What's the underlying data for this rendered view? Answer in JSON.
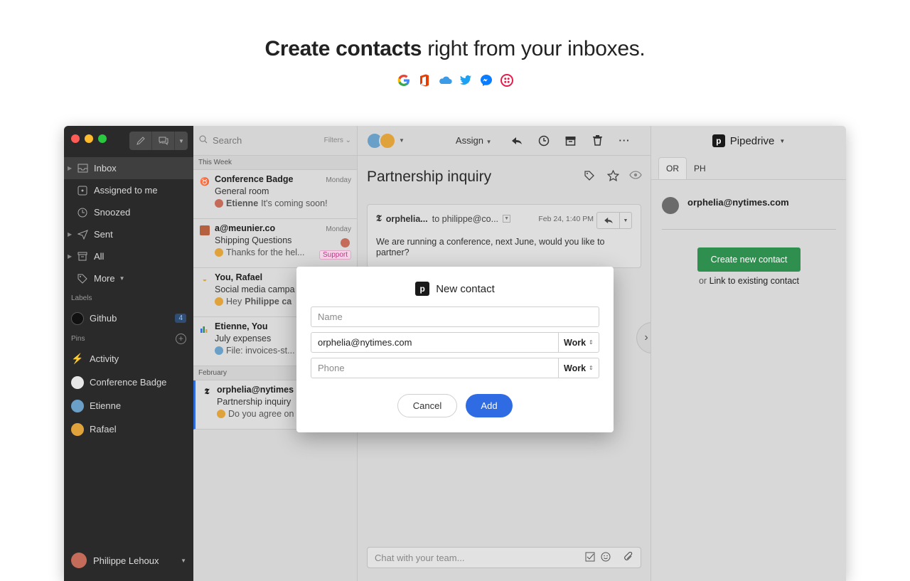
{
  "hero": {
    "title_bold_1": "Create",
    "title_bold_2": "contacts",
    "title_rest": "right from your inboxes.",
    "icons": [
      "google-icon",
      "office-icon",
      "icloud-icon",
      "twitter-icon",
      "messenger-icon",
      "twilio-icon"
    ]
  },
  "sidebar": {
    "nav": [
      {
        "label": "Inbox",
        "icon": "inbox-icon",
        "caret": true
      },
      {
        "label": "Assigned to me",
        "icon": "assigned-icon",
        "caret": false
      },
      {
        "label": "Snoozed",
        "icon": "clock-icon",
        "caret": false
      },
      {
        "label": "Sent",
        "icon": "send-icon",
        "caret": true
      },
      {
        "label": "All",
        "icon": "archive-icon",
        "caret": true
      },
      {
        "label": "More",
        "icon": "tag-icon",
        "caret": false
      }
    ],
    "labels_header": "Labels",
    "labels": [
      {
        "label": "Github",
        "count": "4"
      }
    ],
    "pins_header": "Pins",
    "pins": [
      {
        "label": "Activity"
      },
      {
        "label": "Conference Badge"
      },
      {
        "label": "Etienne"
      },
      {
        "label": "Rafael"
      }
    ],
    "user": "Philippe Lehoux"
  },
  "list": {
    "search_placeholder": "Search",
    "filters": "Filters",
    "this_week": "This Week",
    "february": "February",
    "conversations": [
      {
        "who": "Conference Badge",
        "date": "Monday",
        "subject": "General room",
        "preview_name": "Etienne",
        "preview": "It's coming soon!"
      },
      {
        "who": "a@meunier.co",
        "date": "Monday",
        "subject": "Shipping Questions",
        "preview_name": "",
        "preview": "Thanks for the hel...",
        "tag": "Support"
      },
      {
        "who": "You, Rafael",
        "date": "",
        "subject": "Social media campa",
        "preview_name": "Hey",
        "preview": "Philippe ca"
      },
      {
        "who": "Etienne, You",
        "date": "",
        "subject": "July expenses",
        "preview_name": "",
        "preview": "File: invoices-st..."
      },
      {
        "who": "orphelia@nytimes",
        "date": "",
        "subject": "Partnership inquiry",
        "preview_name": "",
        "preview": "Do you agree on"
      }
    ]
  },
  "main": {
    "assign": "Assign",
    "subject": "Partnership inquiry",
    "message": {
      "from": "orphelia...",
      "to": "to philippe@co...",
      "date": "Feb 24, 1:40 PM",
      "body": "We are running a conference, next June, would you like to partner?"
    },
    "chat_placeholder": "Chat with your team..."
  },
  "pipedrive": {
    "title": "Pipedrive",
    "tabs": [
      "OR",
      "PH"
    ],
    "email": "orphelia@nytimes.com",
    "create_button": "Create new contact",
    "link_prefix": "or",
    "link_text": "Link to existing contact"
  },
  "dialog": {
    "title": "New contact",
    "name_placeholder": "Name",
    "email_value": "orphelia@nytimes.com",
    "email_type": "Work",
    "phone_placeholder": "Phone",
    "phone_type": "Work",
    "cancel": "Cancel",
    "add": "Add"
  },
  "colors": {
    "accent": "#2f6be3",
    "create_green": "#2f8f4e",
    "support_pink": "#c0368a"
  }
}
